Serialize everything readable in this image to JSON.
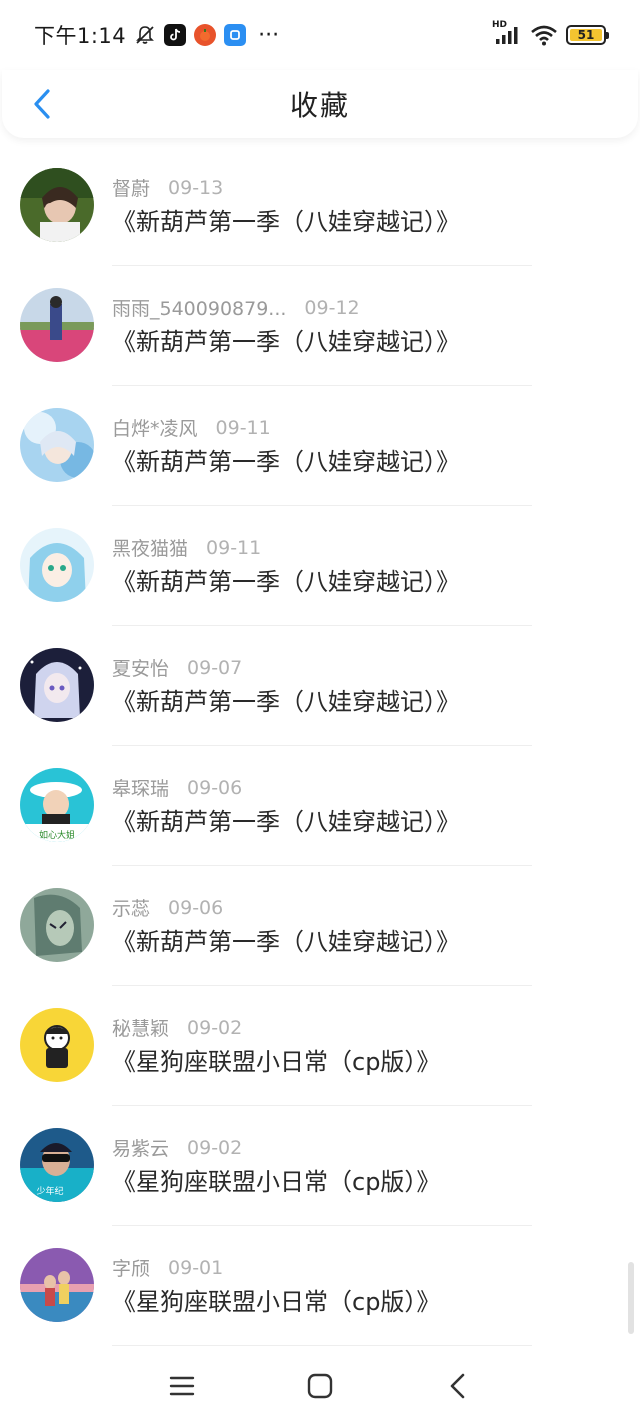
{
  "status_bar": {
    "time": "下午1:14",
    "more": "···",
    "network": "HD",
    "battery": "51"
  },
  "header": {
    "title": "收藏"
  },
  "items": [
    {
      "user": "督蔚",
      "date": "09-13",
      "title": "《新葫芦第一季（八娃穿越记）》"
    },
    {
      "user": "雨雨_540090879...",
      "date": "09-12",
      "title": "《新葫芦第一季（八娃穿越记）》"
    },
    {
      "user": "白烨*凌风",
      "date": "09-11",
      "title": "《新葫芦第一季（八娃穿越记）》"
    },
    {
      "user": "黑夜猫猫",
      "date": "09-11",
      "title": "《新葫芦第一季（八娃穿越记）》"
    },
    {
      "user": "夏安怡",
      "date": "09-07",
      "title": "《新葫芦第一季（八娃穿越记）》"
    },
    {
      "user": "皋琛瑞",
      "date": "09-06",
      "title": "《新葫芦第一季（八娃穿越记）》"
    },
    {
      "user": "示蕊",
      "date": "09-06",
      "title": "《新葫芦第一季（八娃穿越记）》"
    },
    {
      "user": "秘慧颖",
      "date": "09-02",
      "title": "《星狗座联盟小日常（cp版）》"
    },
    {
      "user": "易紫云",
      "date": "09-02",
      "title": "《星狗座联盟小日常（cp版）》"
    },
    {
      "user": "字颀",
      "date": "09-01",
      "title": "《星狗座联盟小日常（cp版）》"
    }
  ],
  "avatar_badges": {
    "item5": "如心大姐",
    "item8": "少年纪"
  },
  "colors": {
    "accent": "#2a8ff0",
    "meta_text": "#9a9a9a",
    "title_text": "#2a2a2a"
  },
  "nav": {
    "menu_icon": "menu-icon",
    "home_icon": "home-icon",
    "back_icon": "back-icon"
  }
}
